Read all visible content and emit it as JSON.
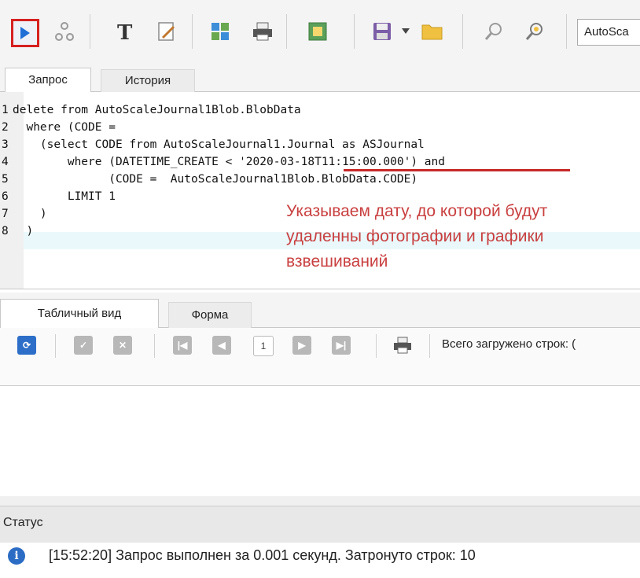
{
  "toolbar": {
    "buttons": [
      "run-icon",
      "schema-icon",
      "text-icon",
      "edit-icon",
      "puzzle-icon",
      "print-icon",
      "export-icon",
      "save-icon",
      "dropdown-icon",
      "open-folder-icon",
      "find-icon",
      "find-replace-icon"
    ],
    "autoscale_label": "AutoSca"
  },
  "top_tabs": {
    "query": "Запрос",
    "history": "История"
  },
  "editor": {
    "lines": [
      {
        "n": "1",
        "text": "delete from AutoScaleJournal1Blob.BlobData"
      },
      {
        "n": "2",
        "text": "  where (CODE ="
      },
      {
        "n": "3",
        "text": "    (select CODE from AutoScaleJournal1.Journal as ASJournal"
      },
      {
        "n": "4",
        "text": "        where (DATETIME_CREATE < '2020-03-18T11:15:00.000') and"
      },
      {
        "n": "5",
        "text": "              (CODE =  AutoScaleJournal1Blob.BlobData.CODE)"
      },
      {
        "n": "6",
        "text": "        LIMIT 1"
      },
      {
        "n": "7",
        "text": "    )"
      },
      {
        "n": "8",
        "text": "  )"
      }
    ],
    "annotation": [
      "Указываем дату, до которой будут",
      "удаленны фотографии и графики",
      "взвешиваний"
    ]
  },
  "result_tabs": {
    "table": "Табличный вид",
    "form": "Форма"
  },
  "nav": {
    "page": "1",
    "loaded_label": "Всего загружено строк: ("
  },
  "status": {
    "title": "Статус",
    "message": "[15:52:20]  Запрос выполнен за 0.001 секунд. Затронуто строк: 10"
  },
  "colors": {
    "accent_red": "#d62020",
    "annotation": "#c94040",
    "info_blue": "#2b6cc4"
  }
}
